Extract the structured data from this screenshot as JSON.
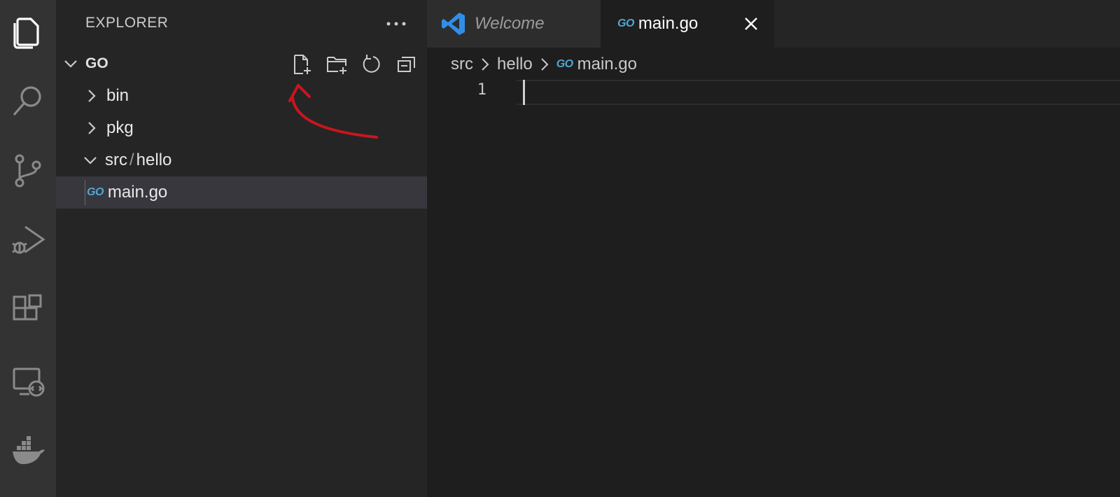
{
  "activity_bar": {
    "icons": [
      "files-icon",
      "search-icon",
      "source-control-icon",
      "run-debug-icon",
      "extensions-icon",
      "remote-explorer-icon",
      "docker-icon"
    ]
  },
  "sidebar": {
    "title": "EXPLORER",
    "section": {
      "title": "GO",
      "actions": [
        "new-file-icon",
        "new-folder-icon",
        "refresh-icon",
        "collapse-all-icon"
      ]
    },
    "tree": [
      {
        "label": "bin",
        "type": "folder",
        "expanded": false
      },
      {
        "label": "pkg",
        "type": "folder",
        "expanded": false
      },
      {
        "label": "src",
        "separator": "/",
        "label2": "hello",
        "type": "folder",
        "expanded": true
      },
      {
        "label": "main.go",
        "type": "file",
        "icon_text": "GO",
        "selected": true
      }
    ]
  },
  "tabs": [
    {
      "label": "Welcome",
      "icon": "vscode-logo-icon",
      "active": false
    },
    {
      "label": "main.go",
      "icon_text": "GO",
      "active": true
    }
  ],
  "breadcrumb": [
    "src",
    "hello",
    "main.go"
  ],
  "breadcrumb_file_icon_text": "GO",
  "editor": {
    "line_numbers": [
      "1"
    ]
  },
  "colors": {
    "activity_bar_bg": "#333333",
    "sidebar_bg": "#252526",
    "editor_bg": "#1e1e1e",
    "go_icon": "#4ea9d6",
    "vscode_blue": "#2f8fe8",
    "annotation_red": "#c8161d"
  }
}
